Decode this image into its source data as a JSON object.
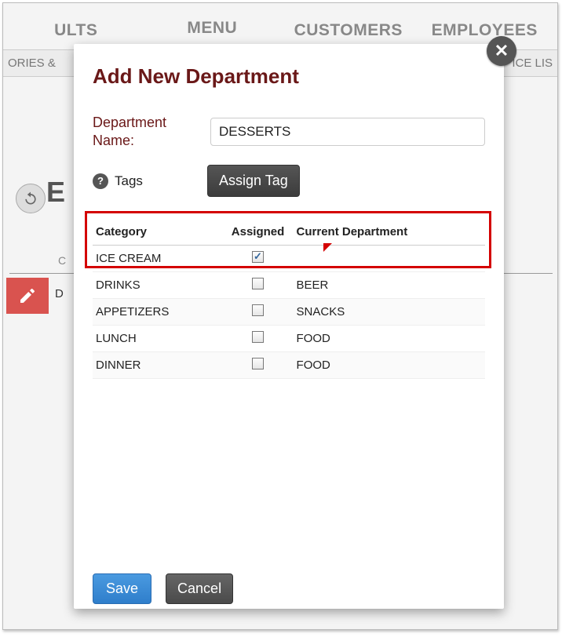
{
  "nav": {
    "tabs": [
      "ULTS",
      "MENU",
      "CUSTOMERS",
      "EMPLOYEES"
    ],
    "active_index": 1,
    "subleft": "ORIES &",
    "subright": "ICE LIS"
  },
  "bg_fragments": {
    "letter_E": "E",
    "letter_C": "C",
    "letter_D": "D"
  },
  "modal": {
    "title": "Add New Department",
    "dep_name_label": "Department Name:",
    "dep_name_value": "DESSERTS",
    "tags_label": "Tags",
    "assign_tag_label": "Assign Tag",
    "columns": {
      "category": "Category",
      "assigned": "Assigned",
      "current": "Current Department"
    },
    "rows": [
      {
        "category": "ICE CREAM",
        "assigned": true,
        "current": ""
      },
      {
        "category": "DRINKS",
        "assigned": false,
        "current": "BEER"
      },
      {
        "category": "APPETIZERS",
        "assigned": false,
        "current": "SNACKS"
      },
      {
        "category": "LUNCH",
        "assigned": false,
        "current": "FOOD"
      },
      {
        "category": "DINNER",
        "assigned": false,
        "current": "FOOD"
      }
    ],
    "save_label": "Save",
    "cancel_label": "Cancel"
  }
}
